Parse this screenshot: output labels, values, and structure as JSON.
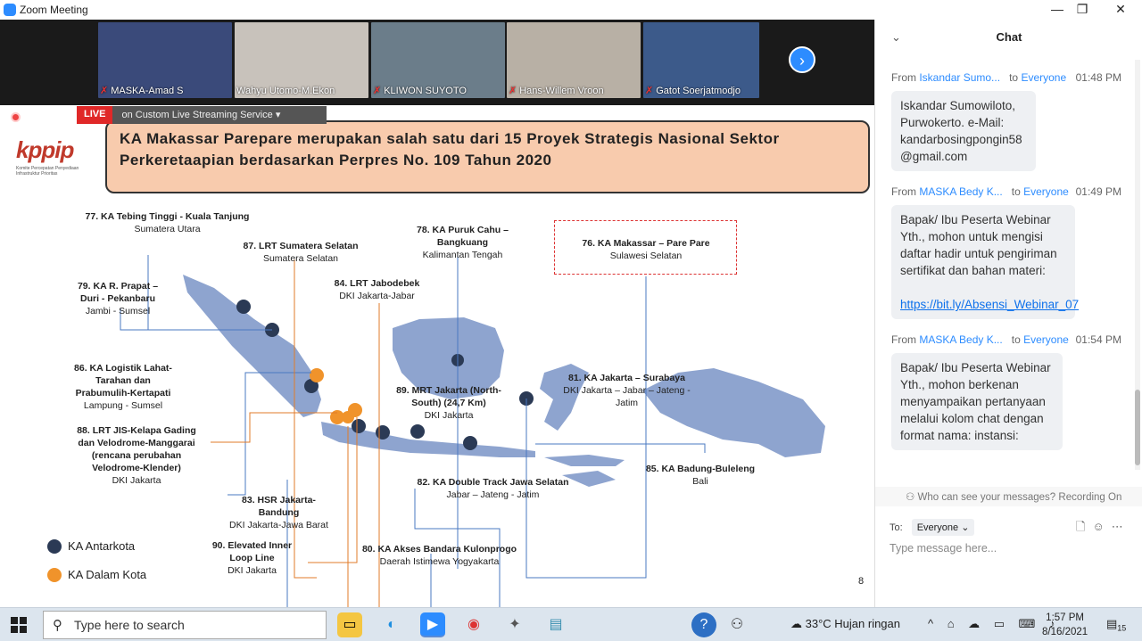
{
  "window": {
    "title": "Zoom Meeting",
    "min": "—",
    "max": "❐",
    "close": "✕"
  },
  "participants": [
    {
      "name": "MASKA-Amad S",
      "bg": "#3a4a7a"
    },
    {
      "name": "Wahyu Utomo-M.Ekon",
      "bg": "#c8c2bb"
    },
    {
      "name": "KLIWON SUYOTO",
      "bg": "#6b7d8a"
    },
    {
      "name": "Hans-Willem Vroon",
      "bg": "#b8b0a5"
    },
    {
      "name": "Gatot Soerjatmodjo",
      "bg": "#3c5a8a"
    }
  ],
  "live": {
    "badge": "LIVE",
    "service": "on Custom Live Streaming Service ▾"
  },
  "slide": {
    "logo": "kppip",
    "logo_sub": "Komite Percepatan Penyediaan Infrastruktur Prioritas",
    "headline": "KA Makassar Parepare merupakan salah satu dari 15 Proyek Strategis Nasional Sektor Perkeretaapian berdasarkan Perpres No. 109 Tahun 2020",
    "page": "8",
    "labels": [
      {
        "t": "77. KA Tebing Tinggi  - Kuala Tanjung",
        "s": "Sumatera Utara"
      },
      {
        "t": "87. LRT Sumatera Selatan",
        "s": "Sumatera Selatan"
      },
      {
        "t": "78. KA Puruk Cahu – Bangkuang",
        "s": "Kalimantan Tengah"
      },
      {
        "t": "76. KA Makassar – Pare Pare",
        "s": "Sulawesi Selatan"
      },
      {
        "t": "79. KA R. Prapat – Duri -  Pekanbaru",
        "s": "Jambi - Sumsel"
      },
      {
        "t": "84. LRT Jabodebek",
        "s": "DKI Jakarta-Jabar"
      },
      {
        "t": "86. KA Logistik Lahat-Tarahan dan Prabumulih-Kertapati",
        "s": "Lampung - Sumsel"
      },
      {
        "t": "89. MRT Jakarta (North-South) (24,7 Km)",
        "s": "DKI Jakarta"
      },
      {
        "t": "81. KA Jakarta – Surabaya",
        "s": "DKI Jakarta – Jabar – Jateng - Jatim"
      },
      {
        "t": "88. LRT JIS-Kelapa Gading dan Velodrome-Manggarai (rencana perubahan Velodrome-Klender)",
        "s": "DKI Jakarta"
      },
      {
        "t": "85. KA Badung-Buleleng",
        "s": "Bali"
      },
      {
        "t": "82. KA Double Track Jawa Selatan",
        "s": "Jabar – Jateng - Jatim"
      },
      {
        "t": "83. HSR Jakarta-Bandung",
        "s": "DKI Jakarta-Jawa Barat"
      },
      {
        "t": "90. Elevated Inner Loop Line",
        "s": "DKI Jakarta"
      },
      {
        "t": "80. KA Akses Bandara Kulonprogo",
        "s": "Daerah Istimewa Yogyakarta"
      }
    ],
    "legend": [
      {
        "label": "KA Antarkota",
        "color": "#2b3a55"
      },
      {
        "label": "KA Dalam Kota",
        "color": "#f0932b"
      }
    ]
  },
  "chat": {
    "title": "Chat",
    "messages": [
      {
        "from": "Iskandar Sumo...",
        "to": "Everyone",
        "time": "01:48 PM",
        "text": "Iskandar Sumowiloto, Purwokerto. e-Mail: kandarbosingpongin58 @gmail.com",
        "link": ""
      },
      {
        "from": "MASKA Bedy K...",
        "to": "Everyone",
        "time": "01:49 PM",
        "text": "Bapak/ Ibu Peserta Webinar Yth., mohon untuk mengisi daftar hadir untuk pengiriman sertifikat dan bahan materi:",
        "link": "https://bit.ly/Absensi_Webinar_07"
      },
      {
        "from": "MASKA Bedy K...",
        "to": "Everyone",
        "time": "01:54 PM",
        "text": "Bapak/ Ibu Peserta Webinar Yth., mohon berkenan menyampaikan pertanyaan melalui kolom chat dengan format nama: instansi:",
        "link": ""
      }
    ],
    "from_label": "From",
    "to_label": "to",
    "who_can_see": "Who can see your messages? Recording On",
    "to": "To:",
    "recipient": "Everyone ⌄",
    "placeholder": "Type message here..."
  },
  "taskbar": {
    "search_placeholder": "Type here to search",
    "weather": "33°C  Hujan ringan",
    "time": "1:57 PM",
    "date": "8/16/2021",
    "notif": "15"
  }
}
